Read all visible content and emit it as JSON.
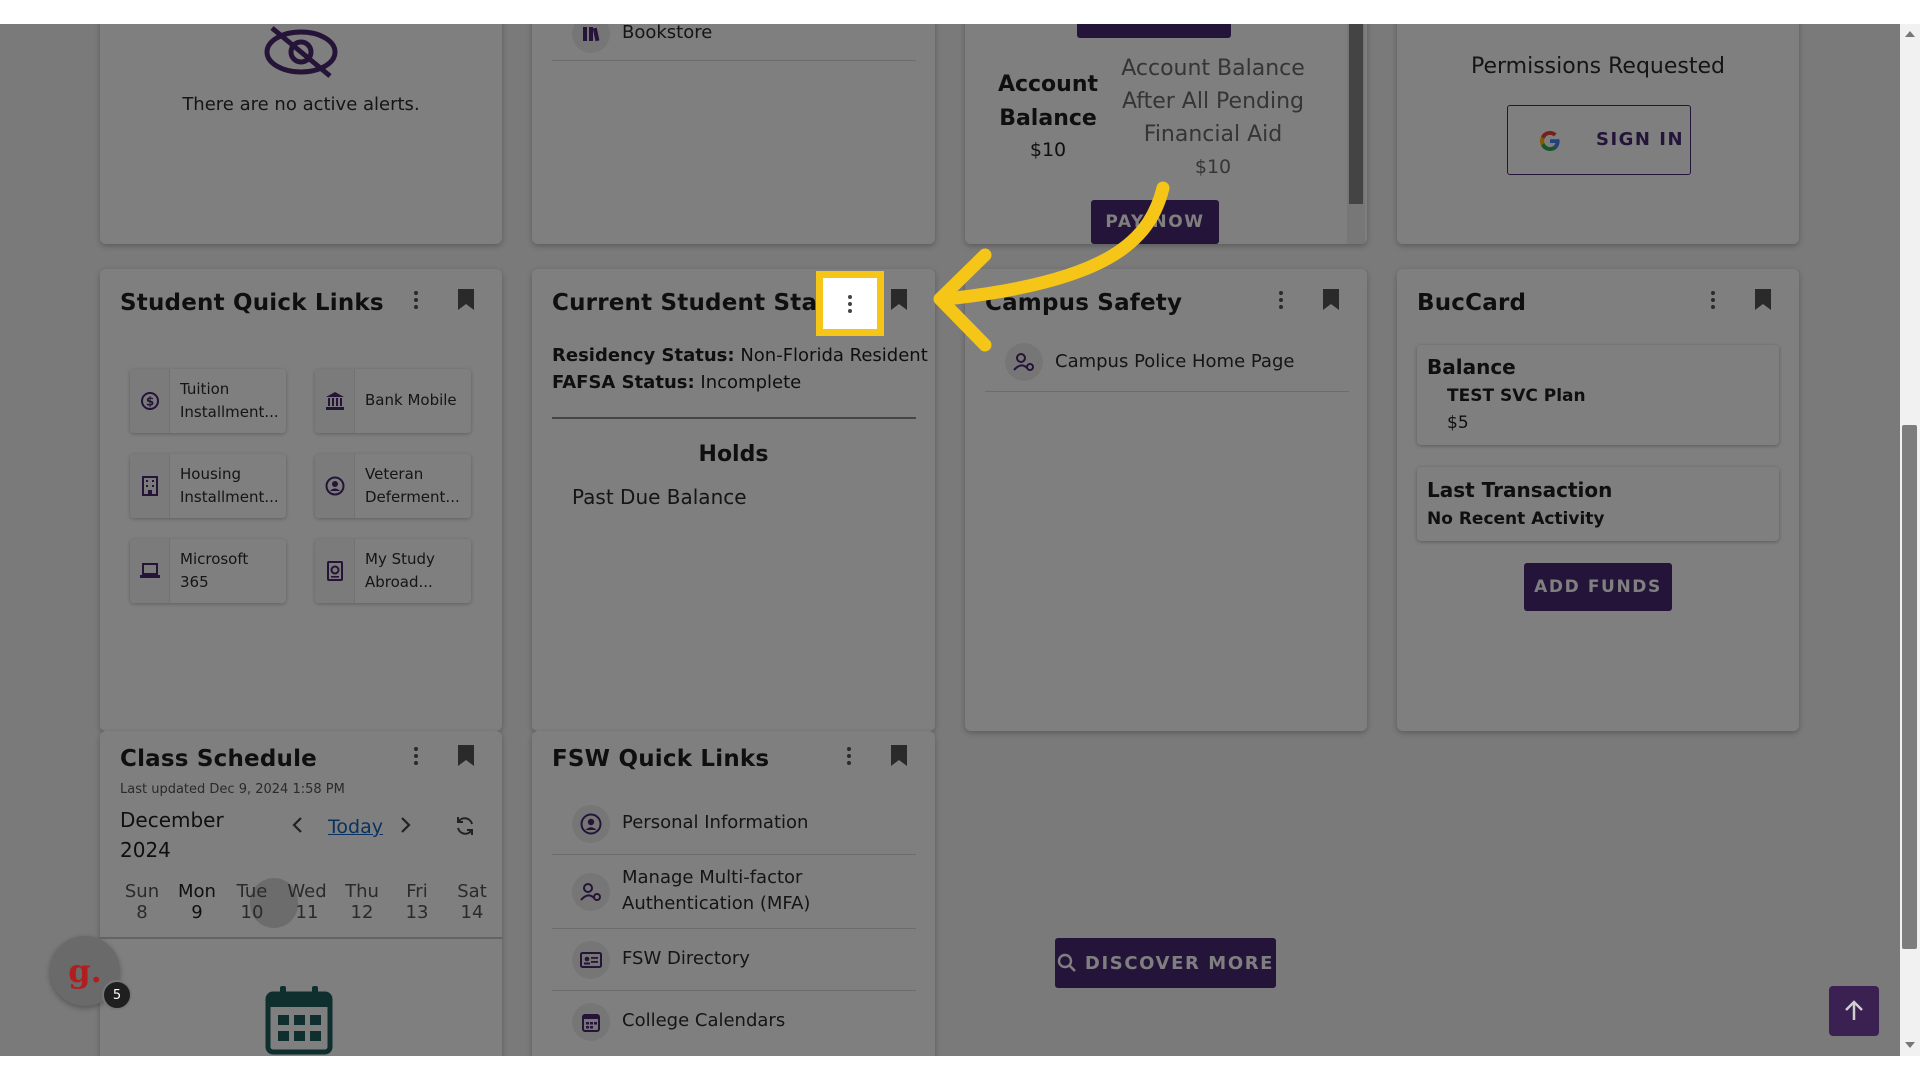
{
  "colors": {
    "brand_purple": "#4b2875",
    "highlight_yellow": "#f5c518",
    "overlay": "rgba(0,0,0,0.5)",
    "calendar_teal": "#1f5f5f"
  },
  "alerts_card": {
    "icon": "eye-slash-icon",
    "message": "There are no active alerts."
  },
  "top_links_card": {
    "items": [
      {
        "icon": "bookstore-icon",
        "label": "Bookstore"
      }
    ]
  },
  "account_card": {
    "balance_label": "Account Balance",
    "balance_value": "$10",
    "pending_label": "Account Balance After All Pending Financial Aid",
    "pending_value": "$10",
    "pay_button": "PAY NOW"
  },
  "google_card": {
    "heading": "Permissions Requested",
    "signin_button": "SIGN IN",
    "icon": "google-icon"
  },
  "student_quick_links": {
    "title": "Student Quick Links",
    "items": [
      {
        "icon": "dollar-circle-icon",
        "line1": "Tuition",
        "line2": "Installment..."
      },
      {
        "icon": "bank-icon",
        "line1": "Bank Mobile",
        "line2": ""
      },
      {
        "icon": "building-icon",
        "line1": "Housing",
        "line2": "Installment..."
      },
      {
        "icon": "person-circle-icon",
        "line1": "Veteran",
        "line2": "Deferment..."
      },
      {
        "icon": "laptop-icon",
        "line1": "Microsoft",
        "line2": "365"
      },
      {
        "icon": "passport-icon",
        "line1": "My Study",
        "line2": "Abroad..."
      }
    ]
  },
  "current_status": {
    "title": "Current Student Status",
    "residency_label": "Residency Status:",
    "residency_value": "Non-Florida Resident",
    "fafsa_label": "FAFSA Status:",
    "fafsa_value": "Incomplete",
    "holds_title": "Holds",
    "holds": [
      "Past Due Balance"
    ]
  },
  "campus_safety": {
    "title": "Campus Safety",
    "items": [
      {
        "icon": "police-person-icon",
        "label": "Campus Police Home Page"
      }
    ]
  },
  "bucard": {
    "title": "BucCard",
    "balance_heading": "Balance",
    "plan_name": "TEST SVC Plan",
    "plan_amount": "$5",
    "last_tx_heading": "Last Transaction",
    "last_tx_value": "No Recent Activity",
    "add_funds_button": "ADD FUNDS"
  },
  "class_schedule": {
    "title": "Class Schedule",
    "last_updated": "Last updated Dec 9, 2024 1:58 PM",
    "month": "December",
    "year": "2024",
    "today_link": "Today",
    "days": [
      {
        "name": "Sun",
        "num": "8"
      },
      {
        "name": "Mon",
        "num": "9"
      },
      {
        "name": "Tue",
        "num": "10"
      },
      {
        "name": "Wed",
        "num": "11"
      },
      {
        "name": "Thu",
        "num": "12"
      },
      {
        "name": "Fri",
        "num": "13"
      },
      {
        "name": "Sat",
        "num": "14"
      }
    ],
    "selected_day_index": 1
  },
  "fsw_quick_links": {
    "title": "FSW Quick Links",
    "items": [
      {
        "icon": "person-circle-icon",
        "label": "Personal Information",
        "label2": ""
      },
      {
        "icon": "person-key-icon",
        "label": "Manage Multi-factor",
        "label2": "Authentication (MFA)"
      },
      {
        "icon": "contact-card-icon",
        "label": "FSW Directory",
        "label2": ""
      },
      {
        "icon": "calendar-icon",
        "label": "College Calendars",
        "label2": ""
      }
    ]
  },
  "discover_button": "DISCOVER MORE",
  "widget": {
    "letter": "g.",
    "badge": "5"
  }
}
